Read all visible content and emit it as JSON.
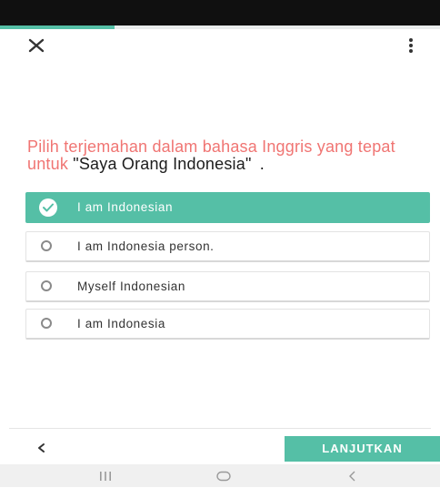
{
  "progress": {
    "fraction": 0.26,
    "color": "#55bfa6"
  },
  "toolbar": {
    "close_icon": "close-icon",
    "menu_icon": "more-vertical-icon"
  },
  "question": {
    "prompt": "Pilih terjemahan dalam bahasa Inggris yang tepat untuk",
    "phrase": "\"Saya Orang Indonesia\"",
    "trailing": "."
  },
  "options": [
    {
      "label": "I am Indonesian",
      "selected": true
    },
    {
      "label": "I am Indonesia person.",
      "selected": false
    },
    {
      "label": "Myself Indonesian",
      "selected": false
    },
    {
      "label": "I am Indonesia",
      "selected": false
    }
  ],
  "footer": {
    "back_icon": "chevron-left-icon",
    "continue_label": "LANJUTKAN"
  },
  "colors": {
    "accent": "#55bfa6",
    "prompt": "#f07573"
  },
  "system_nav": {
    "recents_icon": "recents-icon",
    "home_icon": "home-icon",
    "back_icon": "back-icon"
  }
}
